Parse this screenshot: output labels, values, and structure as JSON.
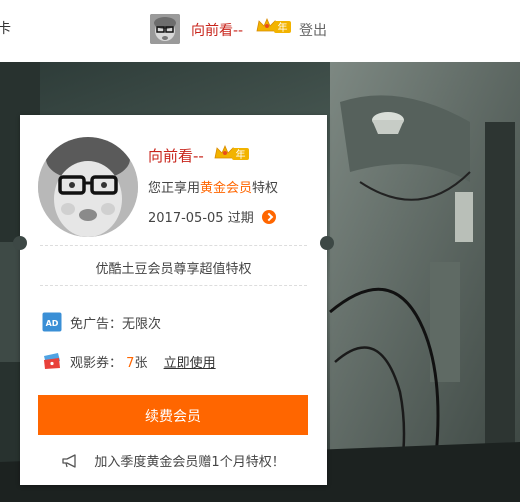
{
  "header": {
    "cut_text": "卡",
    "username": "向前看--",
    "vip_badge": "年",
    "login_label": "登出"
  },
  "card": {
    "username": "向前看--",
    "vip_badge": "年",
    "privilege_prefix": "您正享用",
    "privilege_tier": "黄金会员",
    "privilege_suffix": "特权",
    "expiry_date": "2017-05-05",
    "expiry_label": "过期",
    "subtitle": "优酷土豆会员尊享超值特权",
    "benefits": [
      {
        "icon": "ad-icon",
        "icon_label": "AD",
        "label": "免广告：无限次"
      },
      {
        "icon": "ticket-icon",
        "label": "观影券：",
        "count": "7",
        "unit": "张",
        "link": "立即使用"
      }
    ],
    "renew_label": "续费会员",
    "promo_text": "加入季度黄金会员赠1个月特权！"
  },
  "colors": {
    "accent": "#ff6600",
    "username_red": "#c8251c",
    "text": "#444444"
  }
}
